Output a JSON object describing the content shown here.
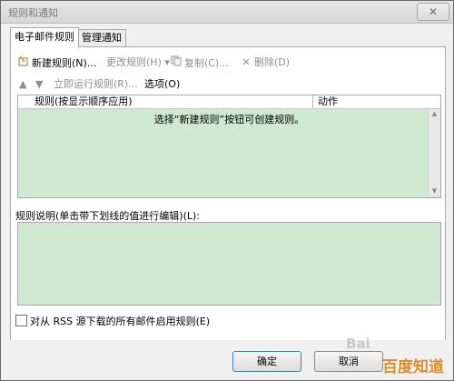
{
  "window": {
    "title": "规则和通知",
    "close_glyph": "✕"
  },
  "tabs": [
    {
      "label": "电子邮件规则",
      "active": true
    },
    {
      "label": "管理通知",
      "active": false
    }
  ],
  "toolbar": {
    "new_rule": "新建规则(N)...",
    "change_rule": "更改规则(H)",
    "copy": "复制(C)...",
    "delete": "删除(D)",
    "run_now": "立即运行规则(R)...",
    "options": "选项(O)"
  },
  "rules_list": {
    "columns": [
      "规则(按显示顺序应用)",
      "动作"
    ],
    "empty_message": "选择“新建规则”按钮可创建规则。"
  },
  "description": {
    "label": "规则说明(单击带下划线的值进行编辑)(L):"
  },
  "rss": {
    "label": "对从 RSS 源下载的所有邮件启用规则(E)",
    "checked": false
  },
  "buttons": {
    "ok": "确定",
    "cancel": "取消"
  },
  "watermark": {
    "text_left": "Bai",
    "logo": "百度知道"
  },
  "colors": {
    "list_background": "#cfe8cf",
    "window_background": "#f0f0f0"
  }
}
